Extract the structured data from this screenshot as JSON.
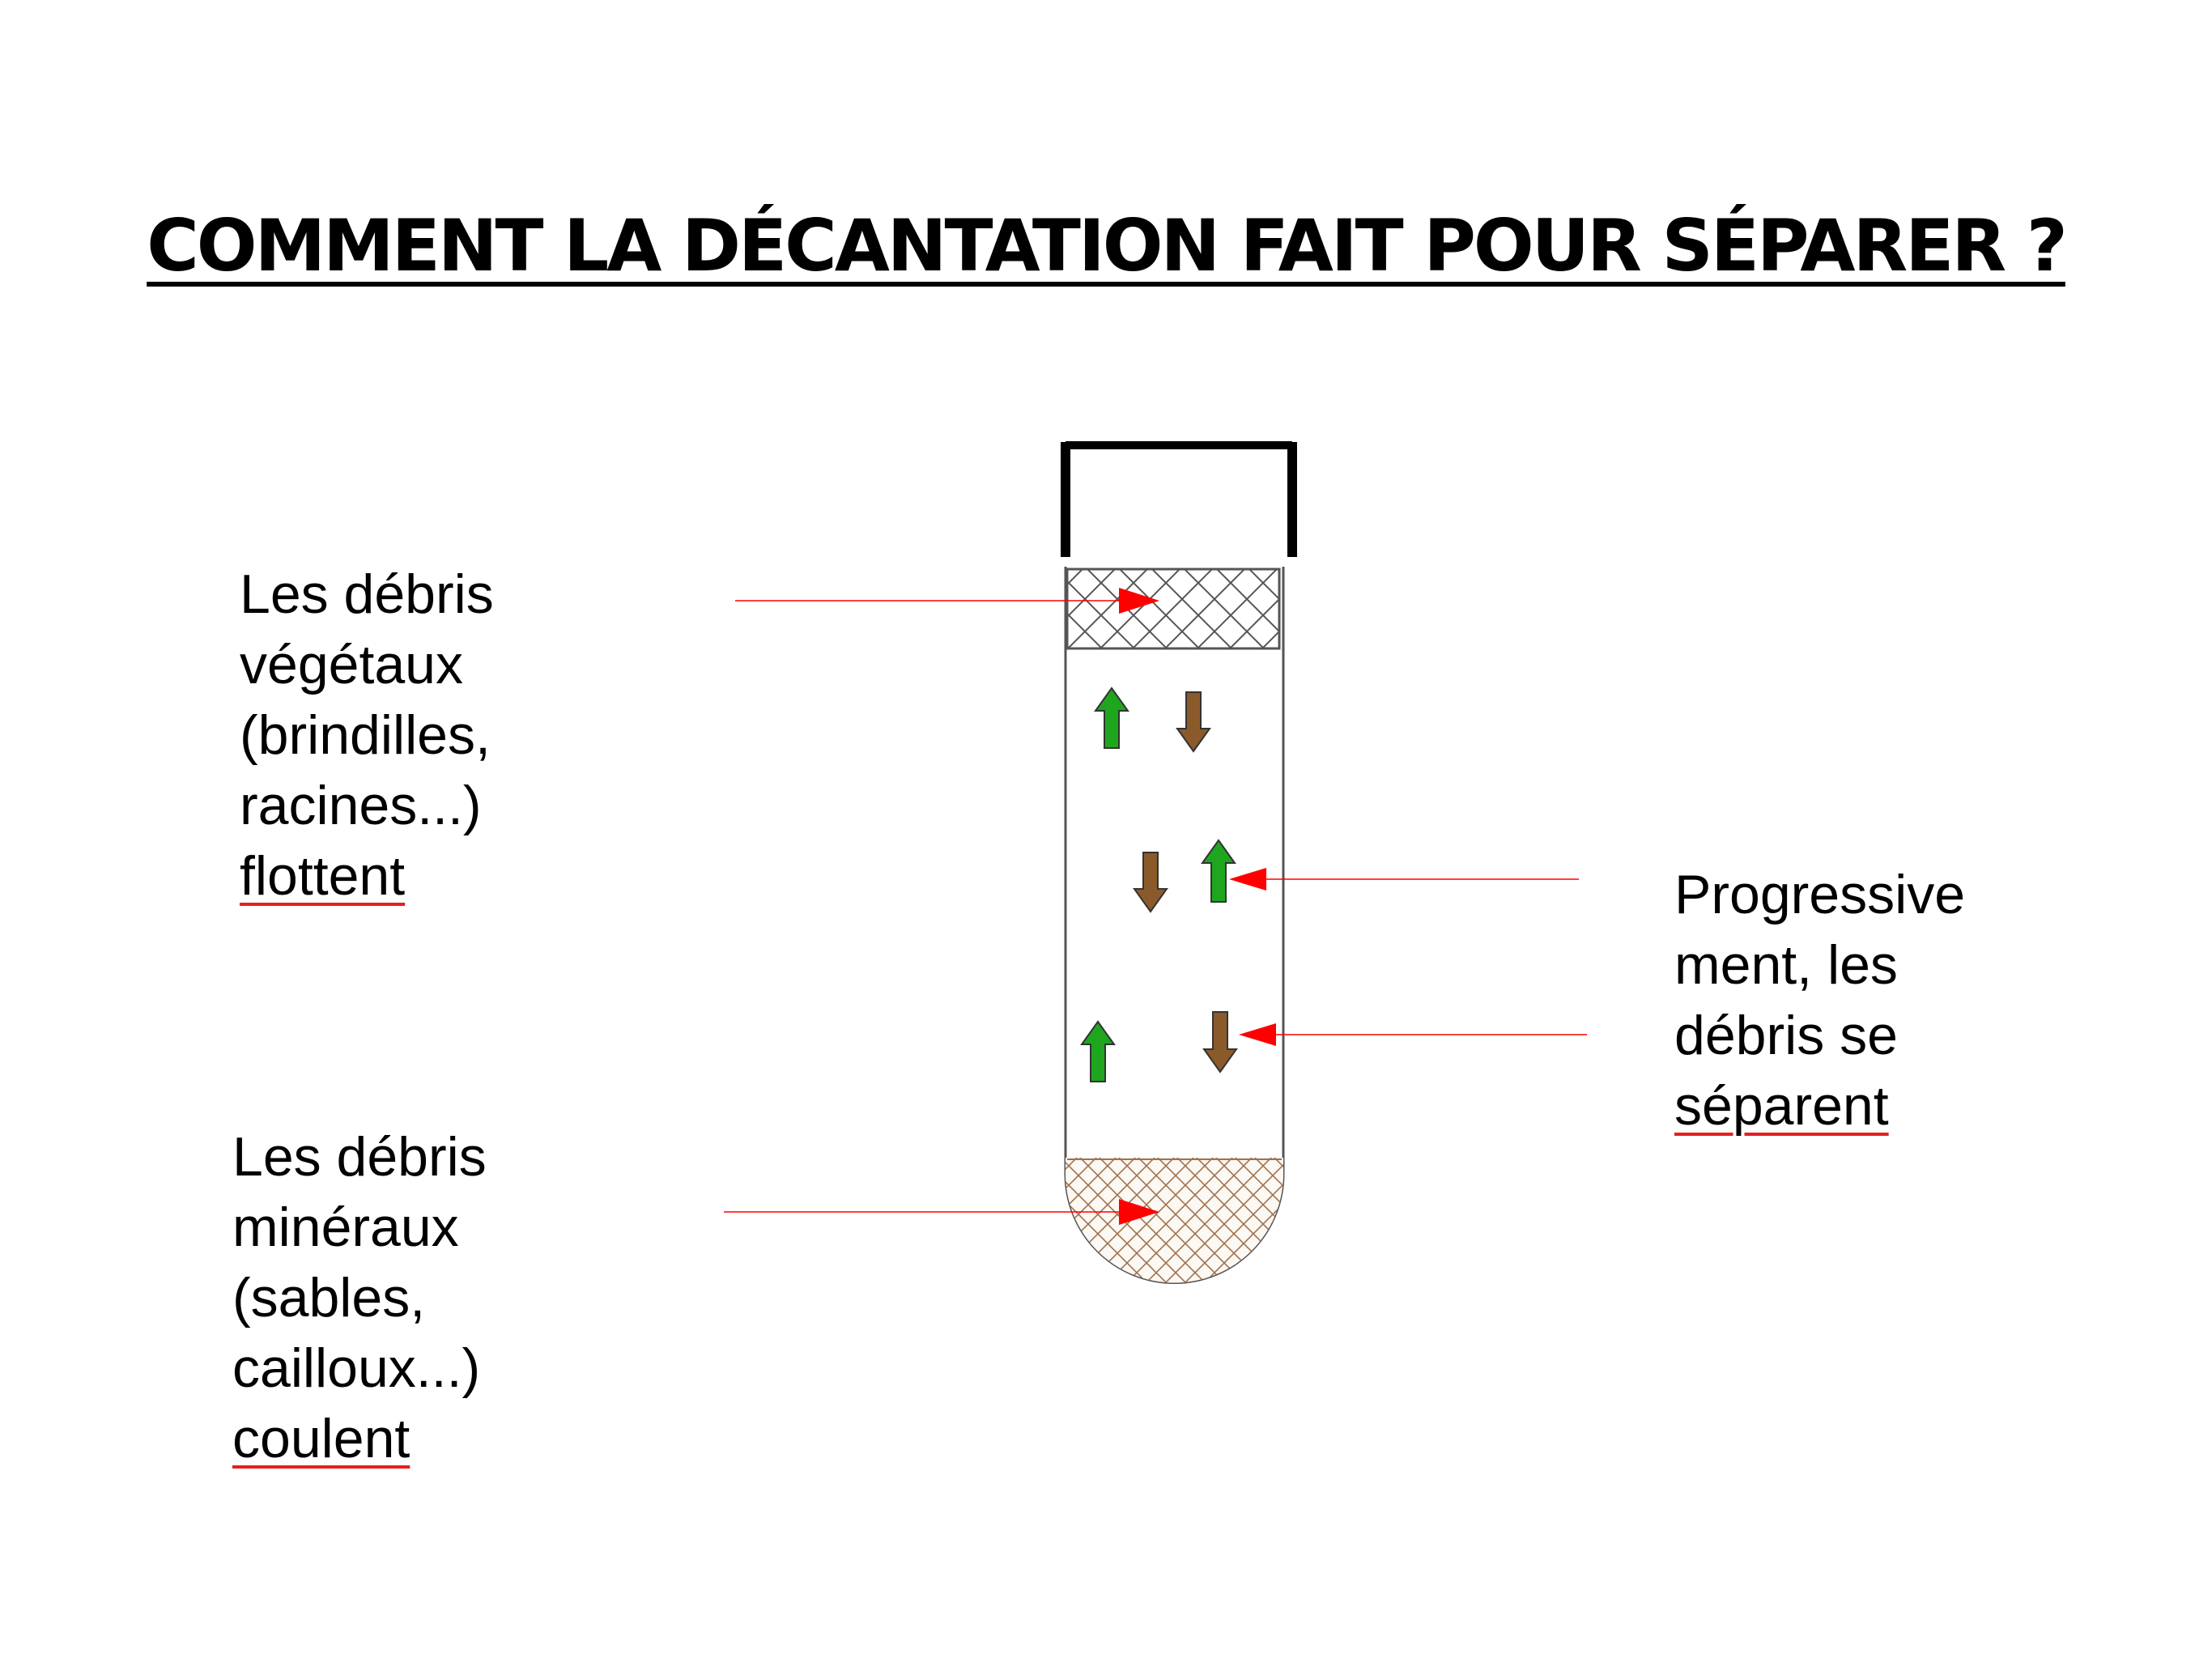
{
  "title": "COMMENT LA DÉCANTATION FAIT POUR SÉPARER ?",
  "labels": {
    "vegetal": {
      "lines": [
        "Les débris",
        "végétaux",
        "(brindilles,",
        "racines...)"
      ],
      "emphasis": "flottent"
    },
    "mineral": {
      "lines": [
        "Les débris",
        "minéraux",
        "(sables,",
        "cailloux...)"
      ],
      "emphasis": "coulent"
    },
    "progress": {
      "lines": [
        "Progressive",
        "ment, les",
        "débris se"
      ],
      "emphasis": "séparent"
    }
  },
  "colors": {
    "pointer": "#ff0000",
    "rising_arrow": "#1fa61f",
    "sinking_arrow": "#8b5a2b",
    "vegetal_layer_hatch": "#555555",
    "mineral_layer_hatch": "#a0724f",
    "emphasis_underline": "#e52020"
  },
  "icons": {
    "rising": "arrow-up-icon",
    "sinking": "arrow-down-icon"
  }
}
